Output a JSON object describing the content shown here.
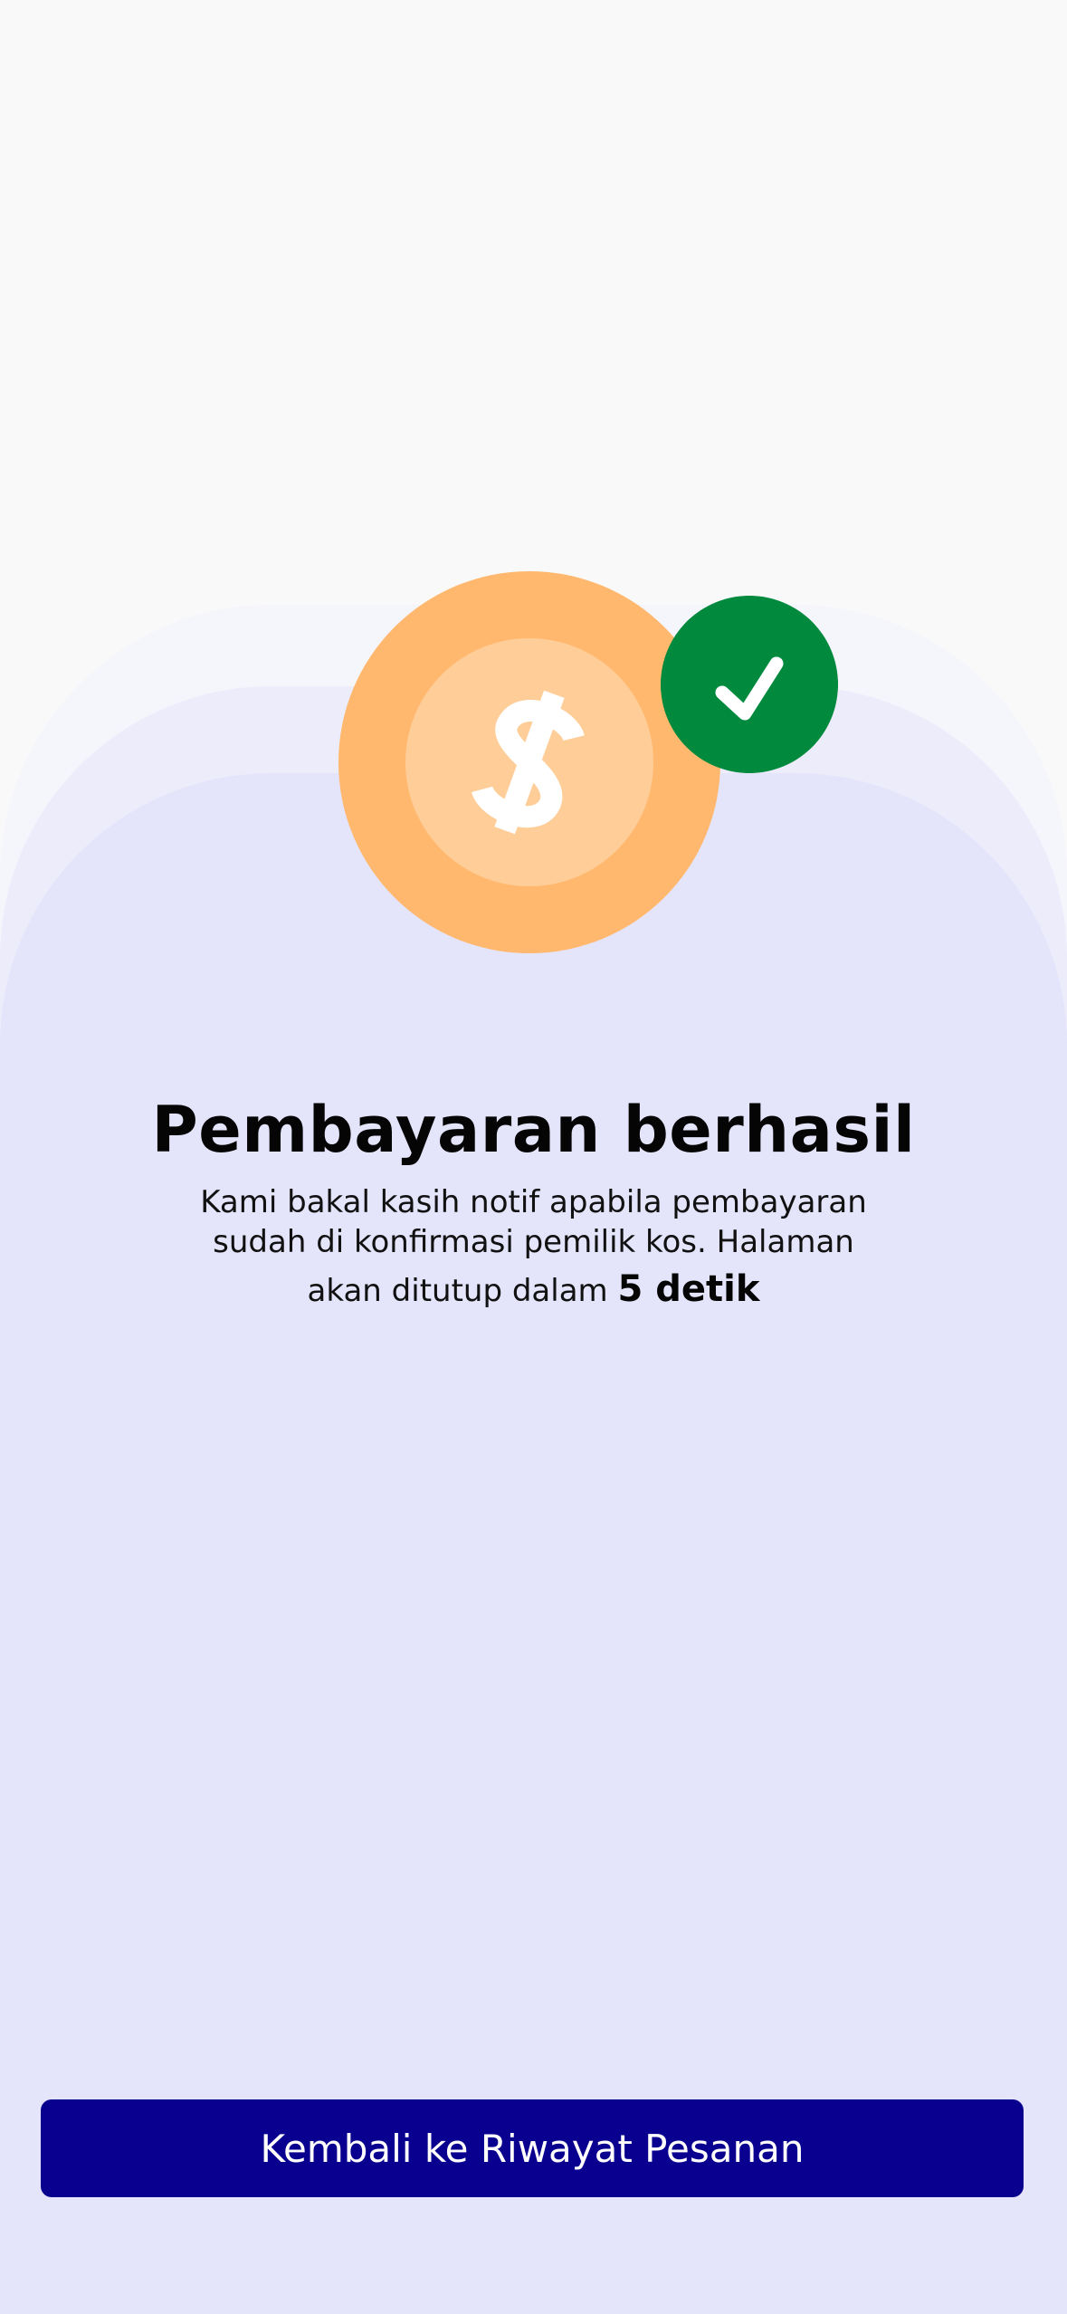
{
  "illustration": {
    "coin_icon": "dollar-coin-icon",
    "badge_icon": "verified-check-badge-icon",
    "colors": {
      "coin_outer": "#ffb86e",
      "coin_inner": "#ffcd98",
      "badge": "#018a3e",
      "check": "#ffffff"
    }
  },
  "success": {
    "title": "Pembayaran berhasil",
    "message_line1": "Kami bakal kasih notif apabila pembayaran",
    "message_line2": "sudah di konfirmasi pemilik kos. Halaman",
    "message_line3_prefix": "akan ditutup dalam",
    "countdown": "5 detik"
  },
  "actions": {
    "back_label": "Kembali ke Riwayat Pesanan",
    "button_color": "#0a008f"
  },
  "theme": {
    "background": "#f9f9fa",
    "panel": "#e4e4fb"
  }
}
